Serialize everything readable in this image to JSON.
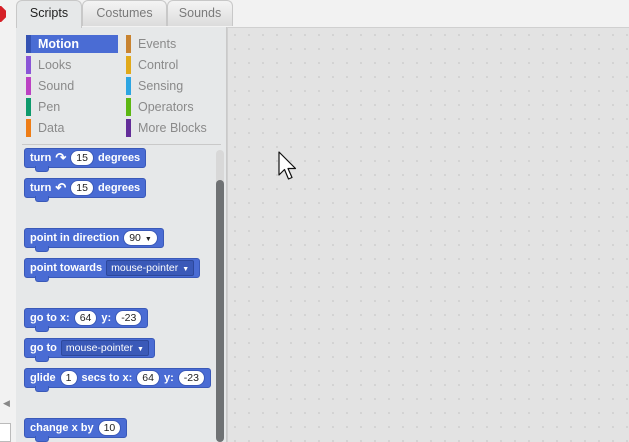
{
  "tabs": [
    {
      "label": "Scripts",
      "active": true
    },
    {
      "label": "Costumes",
      "active": false
    },
    {
      "label": "Sounds",
      "active": false
    }
  ],
  "categories": [
    {
      "label": "Motion",
      "color": "#4a6cd4",
      "selected": true
    },
    {
      "label": "Looks",
      "color": "#8a55d7"
    },
    {
      "label": "Sound",
      "color": "#bb42c3"
    },
    {
      "label": "Pen",
      "color": "#0e9a6c"
    },
    {
      "label": "Data",
      "color": "#ee7d16"
    },
    {
      "label": "Events",
      "color": "#c88330"
    },
    {
      "label": "Control",
      "color": "#e1a91a"
    },
    {
      "label": "Sensing",
      "color": "#2ca5e2"
    },
    {
      "label": "Operators",
      "color": "#5cb712"
    },
    {
      "label": "More Blocks",
      "color": "#632d99"
    }
  ],
  "blocks": {
    "turn_right": {
      "text1": "turn",
      "icon": "↷",
      "value": "15",
      "text2": "degrees"
    },
    "turn_left": {
      "text1": "turn",
      "icon": "↶",
      "value": "15",
      "text2": "degrees"
    },
    "point_in_direction": {
      "text": "point in direction",
      "value": "90"
    },
    "point_towards": {
      "text": "point towards",
      "dropdown": "mouse-pointer"
    },
    "go_to_xy": {
      "text1": "go to x:",
      "x": "64",
      "text2": "y:",
      "y": "-23"
    },
    "go_to": {
      "text": "go to",
      "dropdown": "mouse-pointer"
    },
    "glide": {
      "text1": "glide",
      "secs": "1",
      "text2": "secs to x:",
      "x": "64",
      "text3": "y:",
      "y": "-23"
    },
    "change_x": {
      "text": "change x by",
      "value": "10"
    }
  },
  "left_arrow": "◀"
}
